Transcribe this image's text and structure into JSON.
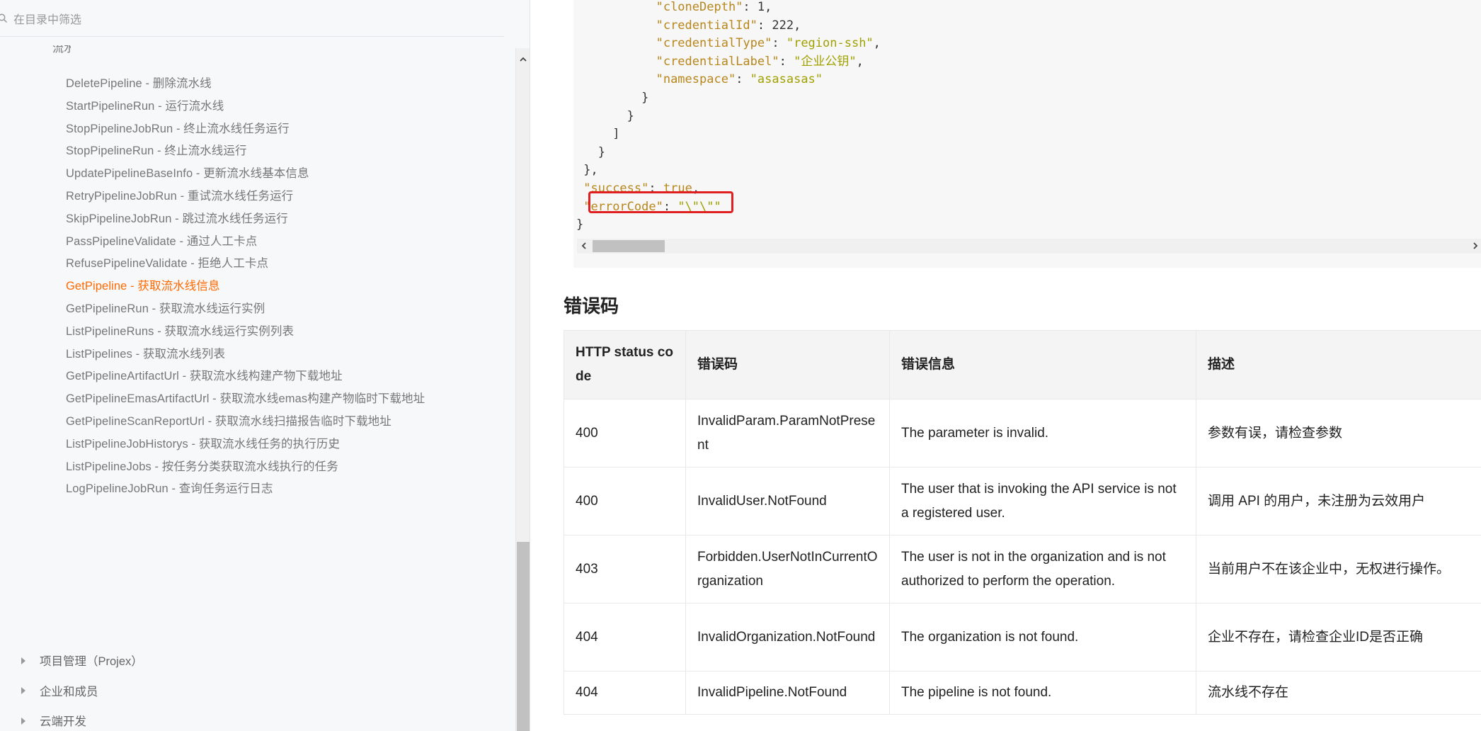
{
  "sidebar": {
    "filter_placeholder": "在目录中筛选",
    "group_label": "流水线",
    "items": [
      {
        "label": "DeletePipeline - 删除流水线",
        "active": false
      },
      {
        "label": "StartPipelineRun - 运行流水线",
        "active": false
      },
      {
        "label": "StopPipelineJobRun - 终止流水线任务运行",
        "active": false
      },
      {
        "label": "StopPipelineRun - 终止流水线运行",
        "active": false
      },
      {
        "label": "UpdatePipelineBaseInfo - 更新流水线基本信息",
        "active": false
      },
      {
        "label": "RetryPipelineJobRun - 重试流水线任务运行",
        "active": false
      },
      {
        "label": "SkipPipelineJobRun - 跳过流水线任务运行",
        "active": false
      },
      {
        "label": "PassPipelineValidate - 通过人工卡点",
        "active": false
      },
      {
        "label": "RefusePipelineValidate - 拒绝人工卡点",
        "active": false
      },
      {
        "label": "GetPipeline - 获取流水线信息",
        "active": true
      },
      {
        "label": "GetPipelineRun - 获取流水线运行实例",
        "active": false
      },
      {
        "label": "ListPipelineRuns - 获取流水线运行实例列表",
        "active": false
      },
      {
        "label": "ListPipelines - 获取流水线列表",
        "active": false
      },
      {
        "label": "GetPipelineArtifactUrl - 获取流水线构建产物下载地址",
        "active": false
      },
      {
        "label": "GetPipelineEmasArtifactUrl - 获取流水线emas构建产物临时下载地址",
        "active": false
      },
      {
        "label": "GetPipelineScanReportUrl - 获取流水线扫描报告临时下载地址",
        "active": false
      },
      {
        "label": "ListPipelineJobHistorys - 获取流水线任务的执行历史",
        "active": false
      },
      {
        "label": "ListPipelineJobs - 按任务分类获取流水线执行的任务",
        "active": false
      },
      {
        "label": "LogPipelineJobRun - 查询任务运行日志",
        "active": false
      }
    ],
    "sections": [
      {
        "label": "项目管理（Projex）"
      },
      {
        "label": "企业和成员"
      },
      {
        "label": "云端开发"
      }
    ]
  },
  "code": {
    "lines": [
      {
        "indent": "           ",
        "key": "\"cloneDepth\"",
        "sep": ": ",
        "val": "1",
        "valtype": "n",
        "tail": ","
      },
      {
        "indent": "           ",
        "key": "\"credentialId\"",
        "sep": ": ",
        "val": "222",
        "valtype": "n",
        "tail": ","
      },
      {
        "indent": "           ",
        "key": "\"credentialType\"",
        "sep": ": ",
        "val": "\"region-ssh\"",
        "valtype": "s",
        "tail": ","
      },
      {
        "indent": "           ",
        "key": "\"credentialLabel\"",
        "sep": ": ",
        "val": "\"企业公钥\"",
        "valtype": "s",
        "tail": ","
      },
      {
        "indent": "           ",
        "key": "\"namespace\"",
        "sep": ": ",
        "val": "\"asasasas\"",
        "valtype": "s",
        "tail": ""
      },
      {
        "indent": "         ",
        "key": "",
        "sep": "",
        "val": "}",
        "valtype": "p",
        "tail": ""
      },
      {
        "indent": "       ",
        "key": "",
        "sep": "",
        "val": "}",
        "valtype": "p",
        "tail": ""
      },
      {
        "indent": "     ",
        "key": "",
        "sep": "",
        "val": "]",
        "valtype": "p",
        "tail": ""
      },
      {
        "indent": "   ",
        "key": "",
        "sep": "",
        "val": "}",
        "valtype": "p",
        "tail": ""
      },
      {
        "indent": " ",
        "key": "",
        "sep": "",
        "val": "},",
        "valtype": "p",
        "tail": ""
      },
      {
        "indent": " ",
        "key": "\"success\"",
        "sep": ": ",
        "val": "true",
        "valtype": "k",
        "tail": ","
      },
      {
        "indent": " ",
        "key": "\"errorCode\"",
        "sep": ": ",
        "val": "\"\\\"\\\"\"",
        "valtype": "s",
        "tail": ""
      },
      {
        "indent": "",
        "key": "",
        "sep": "",
        "val": "}",
        "valtype": "p",
        "tail": ""
      }
    ]
  },
  "error_section": {
    "title": "错误码",
    "headers": [
      "HTTP status code",
      "错误码",
      "错误信息",
      "描述"
    ],
    "rows": [
      [
        "400",
        "InvalidParam.ParamNotPresent",
        "The parameter is invalid.",
        "参数有误，请检查参数"
      ],
      [
        "400",
        "InvalidUser.NotFound",
        "The user that is invoking the API service is not a registered user.",
        "调用 API 的用户，未注册为云效用户"
      ],
      [
        "403",
        "Forbidden.UserNotInCurrentOrganization",
        "The user is not in the organization and is not authorized to perform the operation.",
        "当前用户不在该企业中，无权进行操作。"
      ],
      [
        "404",
        "InvalidOrganization.NotFound",
        "The organization is not found.",
        "企业不存在，请检查企业ID是否正确"
      ],
      [
        "404",
        "InvalidPipeline.NotFound",
        "The pipeline is not found.",
        "流水线不存在"
      ]
    ]
  },
  "colors": {
    "active_link": "#ff6a00",
    "highlight_border": "#e02020",
    "code_key": "#b8861b",
    "code_string": "#a0a000"
  }
}
